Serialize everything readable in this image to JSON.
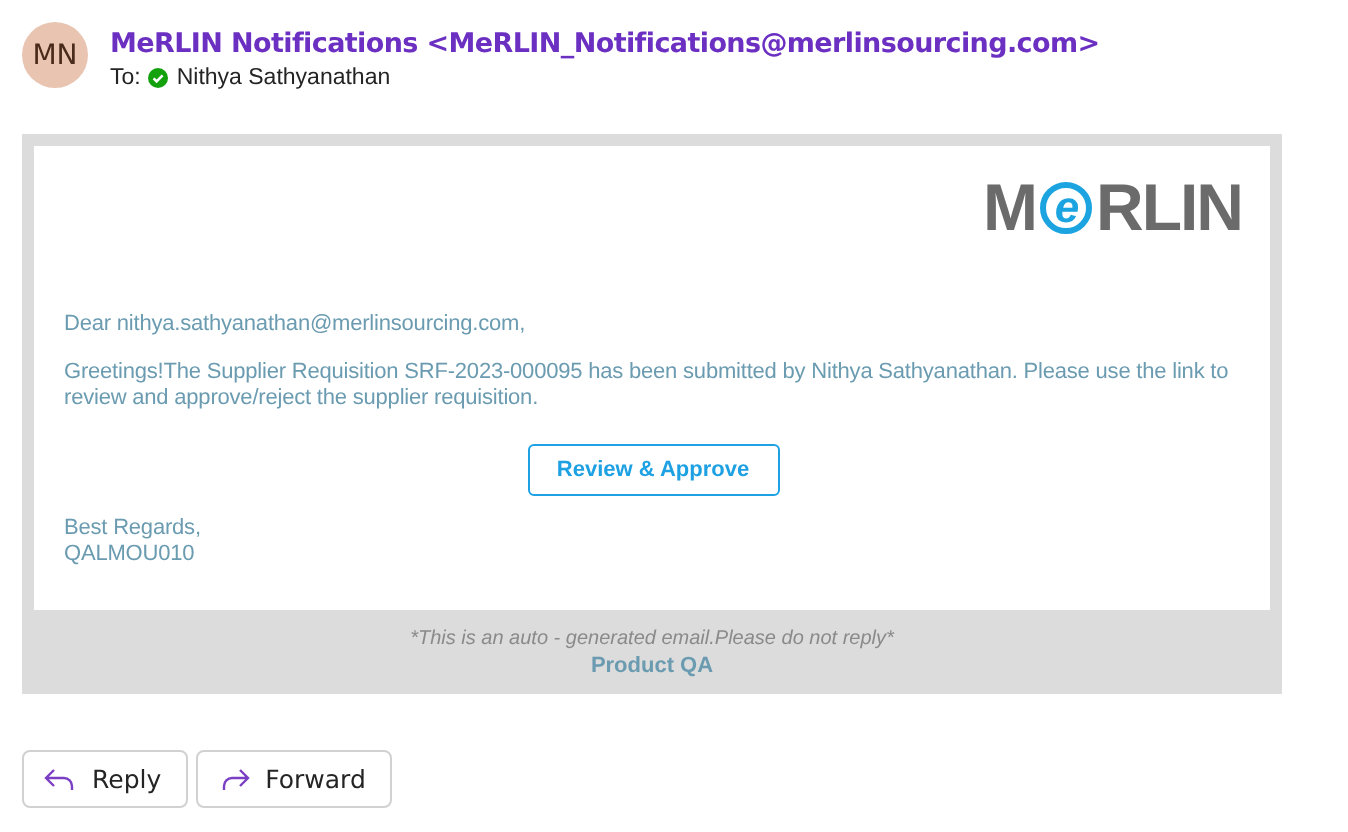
{
  "header": {
    "avatar": "MN",
    "sender": "MeRLIN Notifications <MeRLIN_Notifications@merlinsourcing.com>",
    "to_label": "To:",
    "recipient": "Nithya Sathyanathan"
  },
  "email": {
    "logo": {
      "before": "M",
      "mark": "e",
      "after": "RLIN"
    },
    "greeting": "Dear nithya.sathyanathan@merlinsourcing.com,",
    "message": "Greetings!The Supplier Requisition SRF-2023-000095 has been submitted by Nithya Sathyanathan. Please use the link to review and approve/reject the supplier requisition.",
    "button": "Review & Approve",
    "signoff": [
      "Best Regards,",
      "QALMOU010"
    ],
    "footer_note": "*This is an auto - generated email.Please do not reply*",
    "footer_team": "Product QA"
  },
  "actions": [
    {
      "kind": "reply",
      "label": "Reply"
    },
    {
      "kind": "forward",
      "label": "Forward"
    }
  ]
}
